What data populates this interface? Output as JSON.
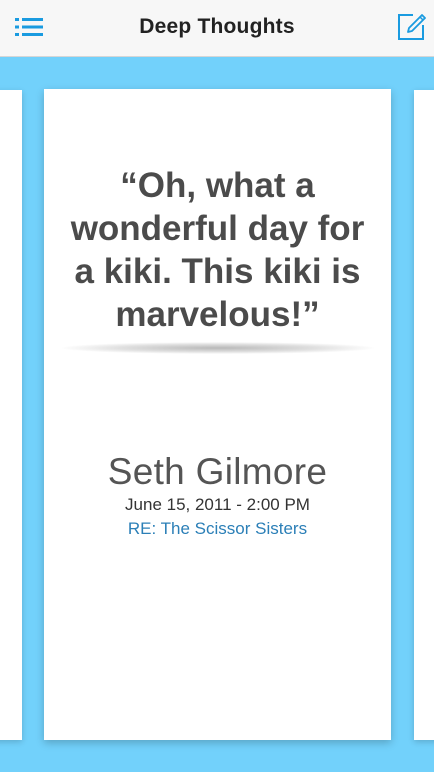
{
  "navbar": {
    "title": "Deep Thoughts",
    "menu_icon": "list-menu-icon",
    "compose_icon": "compose-edit-icon"
  },
  "card": {
    "quote": "“Oh, what a\nwonderful day for\na kiki.  This kiki is\nmarvelous!”",
    "author": "Seth Gilmore",
    "date": "June 15, 2011 - 2:00 PM",
    "topic": "RE: The Scissor Sisters"
  },
  "colors": {
    "background": "#72d1fb",
    "accent": "#1a9be0",
    "topic_link": "#2b7fb7",
    "quote_text": "#4b4b4b"
  }
}
